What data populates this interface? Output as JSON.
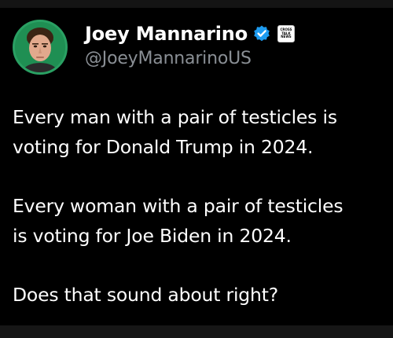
{
  "author": {
    "display_name": "Joey Mannarino",
    "handle": "@JoeyMannarinoUS",
    "verified_icon": "verified-badge-icon",
    "affiliate_badge_text": "CROSS\nTALK\nNEWS",
    "avatar_icon": "profile-photo"
  },
  "post": {
    "paragraphs": [
      {
        "lines": [
          "Every man with a pair of testicles is",
          "voting for Donald Trump in 2024."
        ]
      },
      {
        "lines": [
          "Every woman with a pair of testicles",
          "is voting for Joe Biden in 2024."
        ]
      },
      {
        "lines": [
          "Does that sound about right?"
        ]
      }
    ]
  },
  "colors": {
    "background": "#000000",
    "text": "#ffffff",
    "handle": "#8a8f95",
    "verified": "#1d9bf0",
    "avatar_ring": "#2aa063"
  }
}
